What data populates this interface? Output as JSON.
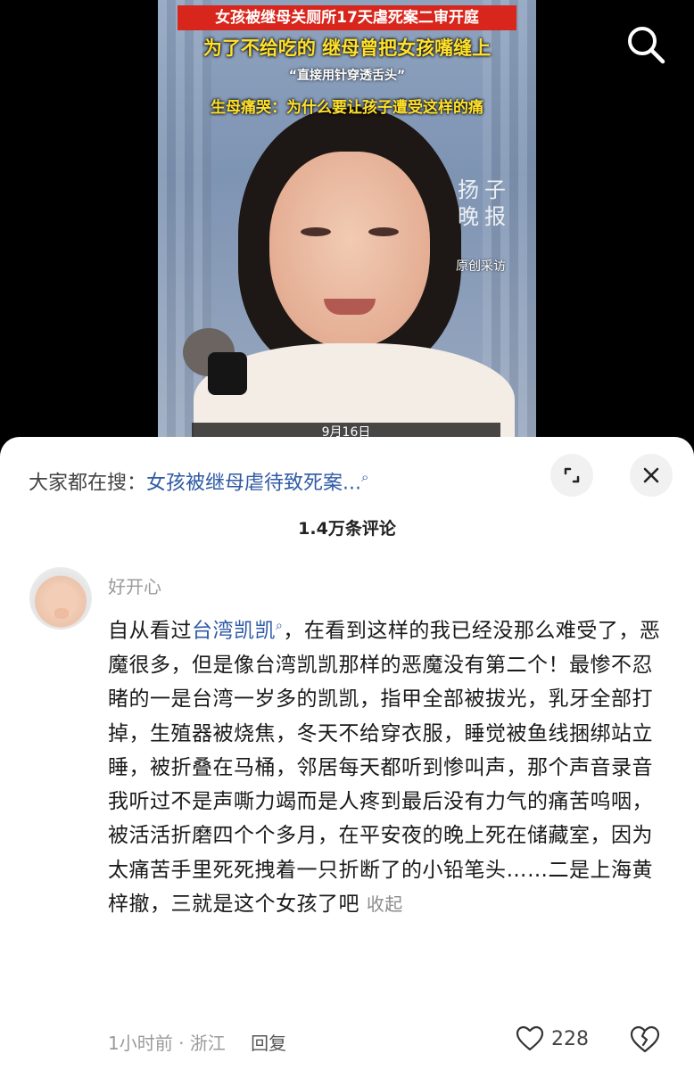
{
  "video": {
    "caption_line1": "女孩被继母关厕所17天虐死案二审开庭",
    "caption_line2_a": "为了不给吃的",
    "caption_line2_b": "继母曾把女孩嘴缝上",
    "caption_line3": "“直接用针穿透舌头”",
    "caption_line4": "生母痛哭：为什么要让孩子遭受这样的痛",
    "watermark": "扬子晚报",
    "watermark_sub": "原创采访",
    "date_strip": "9月16日"
  },
  "top_bar": {
    "search_icon": "search-icon"
  },
  "sheet": {
    "search_prefix": "大家都在搜：",
    "search_query": "女孩被继母虐待致死案...",
    "expand_icon": "expand-icon",
    "close_icon": "close-icon",
    "comment_count": "1.4万条评论"
  },
  "comment": {
    "username": "好开心",
    "text_before_link": "自从看过",
    "link_text": "台湾凯凯",
    "text_after_link": "，在看到这样的我已经没那么难受了，恶魔很多，但是像台湾凯凯那样的恶魔没有第二个！最惨不忍睹的一是台湾一岁多的凯凯，指甲全部被拔光，乳牙全部打掉，生殖器被烧焦，冬天不给穿衣服，睡觉被鱼线捆绑站立睡，被折叠在马桶，邻居每天都听到惨叫声，那个声音录音我听过不是声嘶力竭而是人疼到最后没有力气的痛苦呜咽，被活活折磨四个个多月，在平安夜的晚上死在储藏室，因为太痛苦手里死死拽着一只折断了的小铅笔头……二是上海黄梓撤，三就是这个女孩了吧",
    "collapse_label": "收起",
    "time": "1小时前",
    "separator": "·",
    "location": "浙江",
    "reply_label": "回复",
    "like_count": "228"
  },
  "colors": {
    "link": "#2f5aa5",
    "caption_red": "#d9261c",
    "caption_yellow": "#ffe12b",
    "muted": "#9a9a9a"
  }
}
